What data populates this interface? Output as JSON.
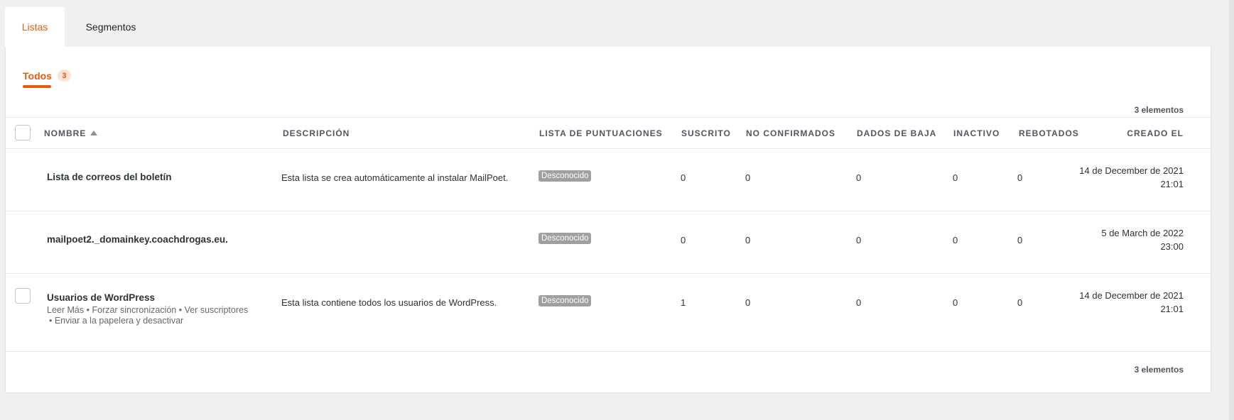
{
  "tabs": [
    {
      "label": "Listas"
    },
    {
      "label": "Segmentos"
    }
  ],
  "filter": {
    "label": "Todos",
    "count": "3"
  },
  "items_count": "3 elementos",
  "columns": {
    "nombre": "NOMBRE",
    "descripcion": "DESCRIPCIÓN",
    "puntuaciones": "LISTA DE PUNTUACIONES",
    "suscrito": "SUSCRITO",
    "no_confirmados": "NO CONFIRMADOS",
    "dados_baja": "DADOS DE BAJA",
    "inactivo": "INACTIVO",
    "rebotados": "REBOTADOS",
    "creado": "CREADO EL"
  },
  "rows": [
    {
      "name": "Lista de correos del boletín",
      "description": "Esta lista se crea automáticamente al instalar MailPoet.",
      "score": "Desconocido",
      "suscrito": "0",
      "no_confirmados": "0",
      "dados_baja": "0",
      "inactivo": "0",
      "rebotados": "0",
      "date": "14 de December de 2021",
      "time": "21:01"
    },
    {
      "name": "mailpoet2._domainkey.coachdrogas.eu.",
      "description": "",
      "score": "Desconocido",
      "suscrito": "0",
      "no_confirmados": "0",
      "dados_baja": "0",
      "inactivo": "0",
      "rebotados": "0",
      "date": "5 de March de 2022",
      "time": "23:00"
    },
    {
      "name": "Usuarios de WordPress",
      "description": "Esta lista contiene todos los usuarios de WordPress.",
      "score": "Desconocido",
      "suscrito": "1",
      "no_confirmados": "0",
      "dados_baja": "0",
      "inactivo": "0",
      "rebotados": "0",
      "date": "14 de December de 2021",
      "time": "21:01",
      "actions": {
        "read_more": "Leer Más",
        "force_sync": "• Forzar sincronización",
        "view_subscribers": "• Ver suscriptores",
        "trash": "• Enviar a la papelera y desactivar"
      }
    }
  ],
  "colors": {
    "accent": "#e55c10",
    "badge_bg": "#a0a0a2",
    "page_bg": "#f0f0f1"
  },
  "icons": {
    "sort": "sort-ascending-icon"
  }
}
